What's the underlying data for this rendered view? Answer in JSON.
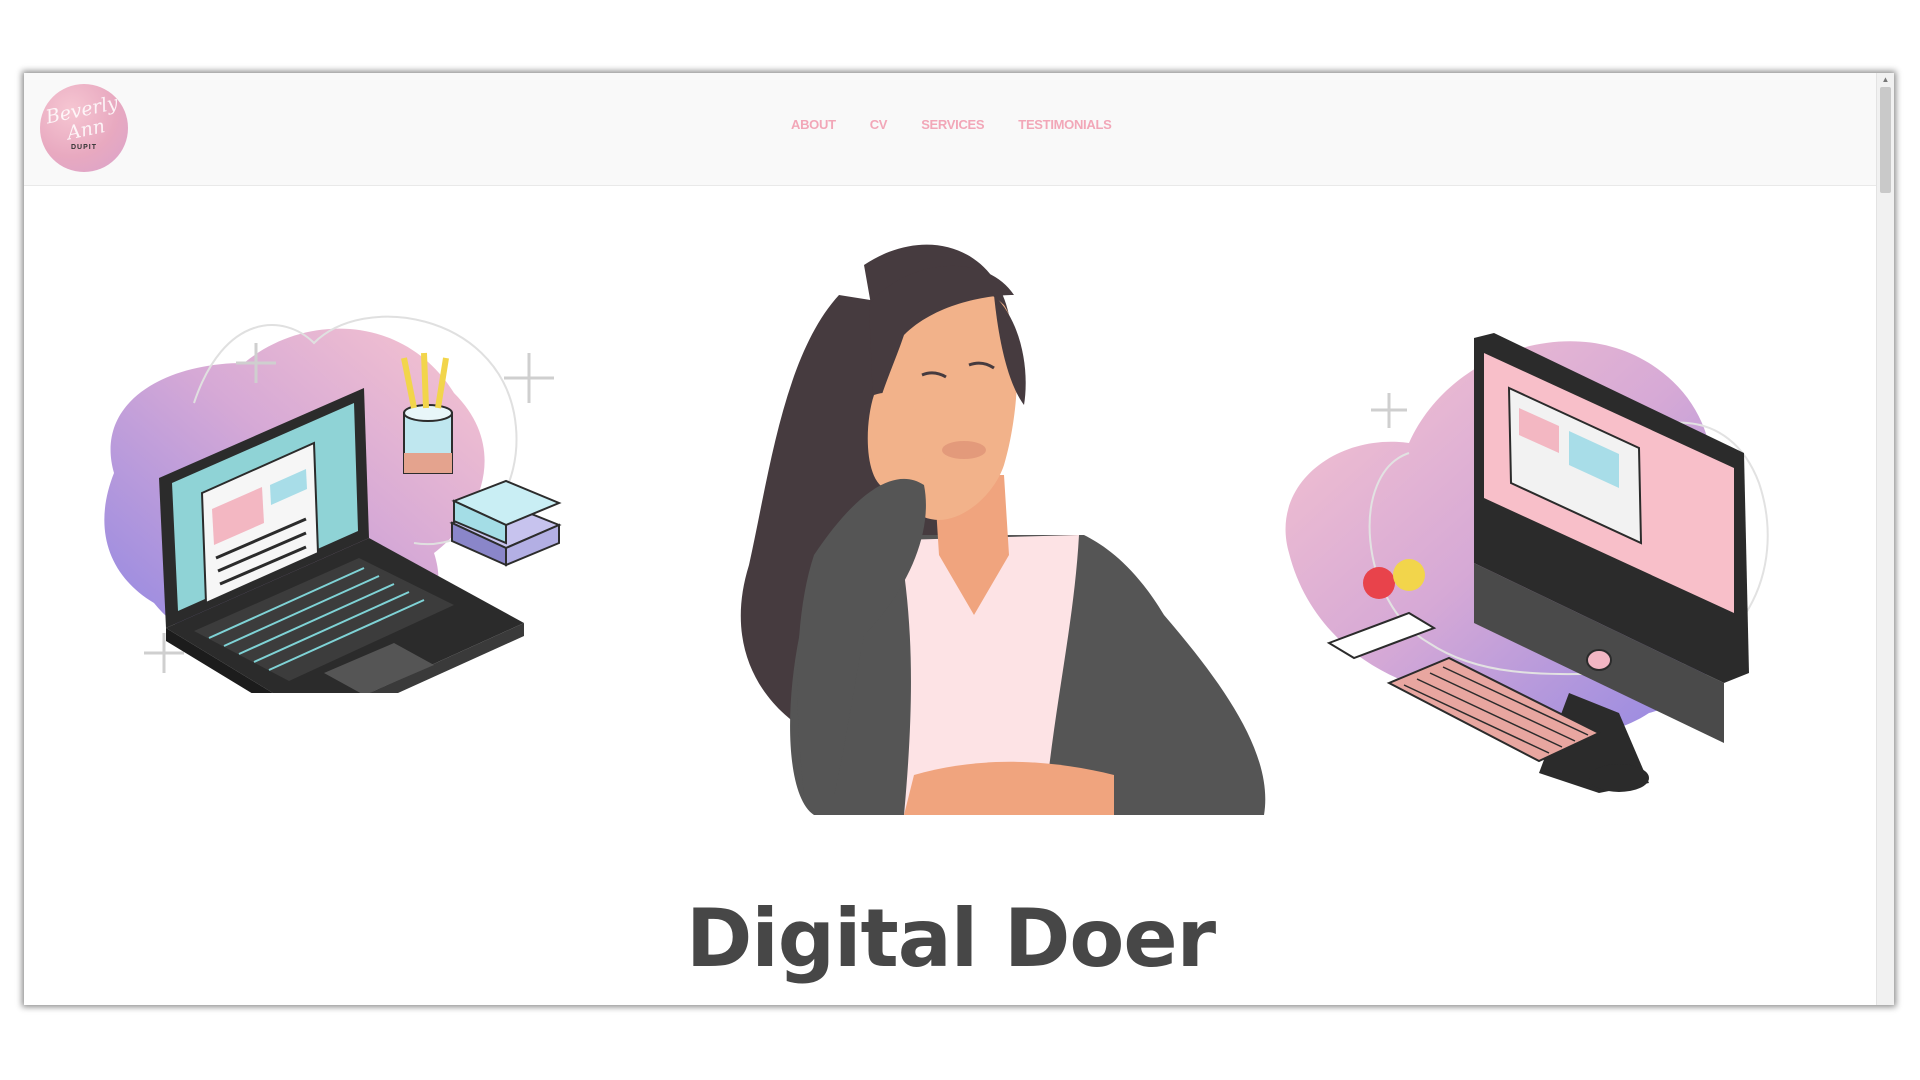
{
  "logo": {
    "script_text": "Beverly Ann",
    "sub_text": "DUPIT"
  },
  "nav": {
    "items": [
      {
        "label": "ABOUT"
      },
      {
        "label": "CV"
      },
      {
        "label": "SERVICES"
      },
      {
        "label": "TESTIMONIALS"
      }
    ]
  },
  "hero": {
    "title": "Digital Doer"
  },
  "colors": {
    "nav_text": "#f2a7b8",
    "title_text": "#474747",
    "accent_pink": "#f6c6d2",
    "accent_purple": "#9b8ce6"
  },
  "icons": {
    "laptop": "laptop-illustration",
    "woman": "woman-thinking-illustration",
    "desktop": "desktop-computer-illustration"
  }
}
